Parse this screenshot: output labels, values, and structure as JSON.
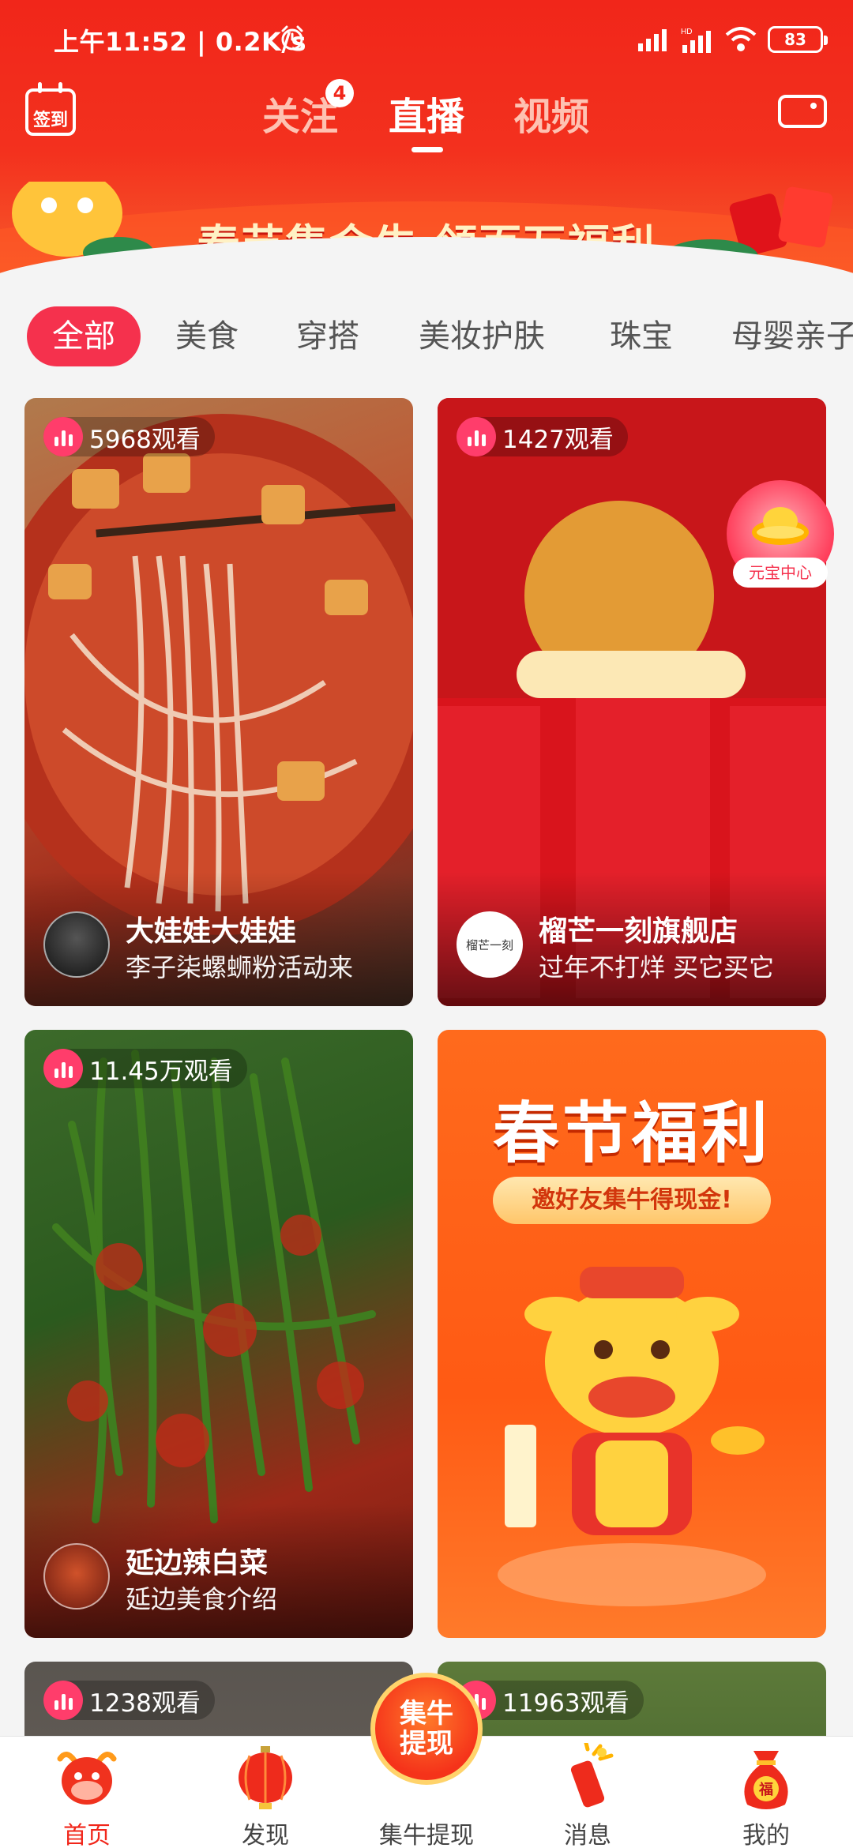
{
  "status_bar": {
    "time_speed": "上午11:52 | 0.2K/s",
    "network": "HD",
    "battery": "83"
  },
  "header": {
    "checkin_label": "签到",
    "tabs": [
      {
        "label": "关注",
        "badge": "4"
      },
      {
        "label": "直播"
      },
      {
        "label": "视频"
      }
    ],
    "banner_text": "春节集金牛 领百万福利"
  },
  "categories": [
    "全部",
    "美食",
    "穿搭",
    "美妆护肤",
    "珠宝",
    "母婴亲子"
  ],
  "cards": [
    {
      "viewers": "5968观看",
      "name": "大娃娃大娃娃",
      "subtitle": "李子柒螺蛳粉活动来"
    },
    {
      "viewers": "1427观看",
      "name": "榴芒一刻旗舰店",
      "subtitle": "过年不打烊 买它买它",
      "avatar_text": "榴芒一刻"
    },
    {
      "viewers": "11.45万观看",
      "name": "延边辣白菜",
      "subtitle": "延边美食介绍"
    },
    {
      "title": "春节福利",
      "ribbon": "邀好友集牛得现金!"
    },
    {
      "viewers": "1238观看"
    },
    {
      "viewers": "11963观看"
    }
  ],
  "floating": {
    "yuanbao_label": "元宝中心"
  },
  "bottom_nav": {
    "items": [
      "首页",
      "发现",
      "集牛提现",
      "消息",
      "我的"
    ],
    "center_button": [
      "集牛",
      "提现"
    ]
  },
  "colors": {
    "brand_red": "#f1261a",
    "accent_pink": "#f5314d"
  }
}
